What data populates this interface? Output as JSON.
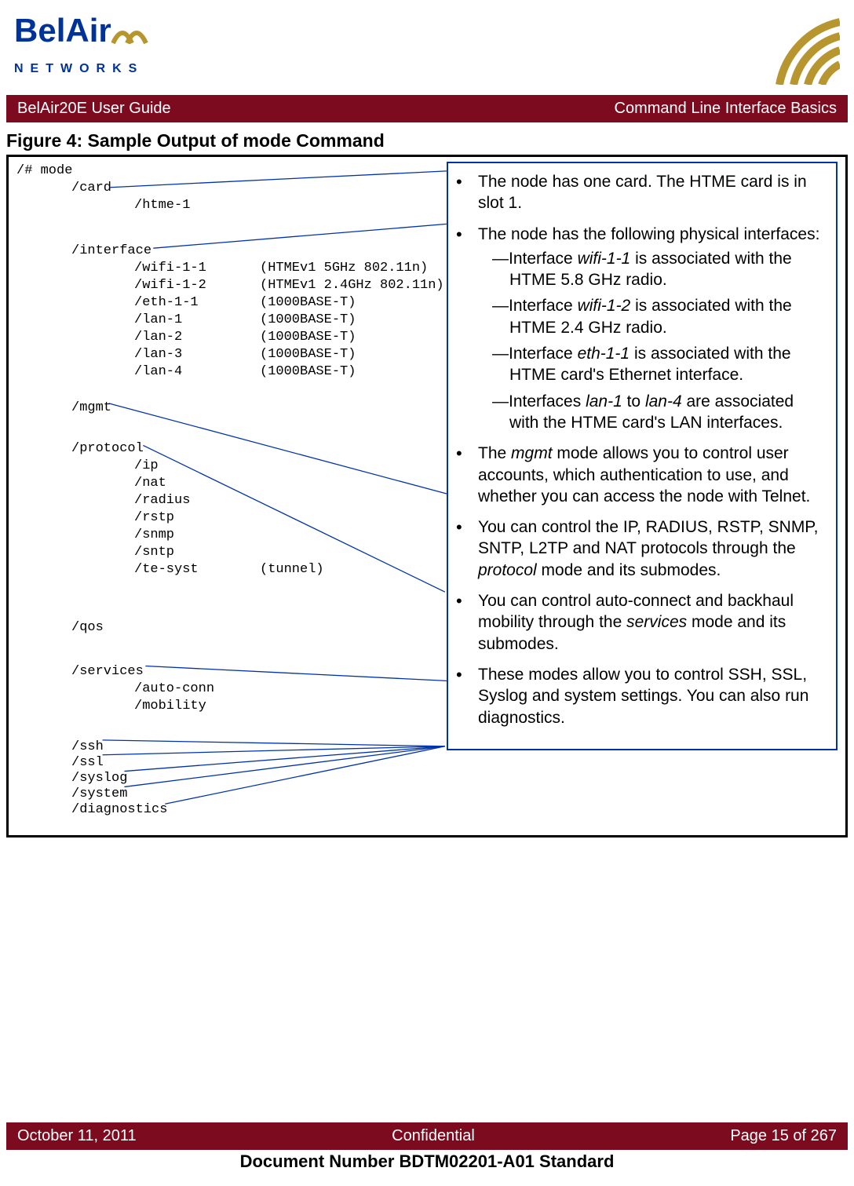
{
  "logo": {
    "brand_top": "BelAir",
    "brand_bottom": "NETWORKS"
  },
  "banner": {
    "left": "BelAir20E User Guide",
    "right": "Command Line Interface Basics"
  },
  "figure_title": "Figure 4: Sample Output of mode Command",
  "cli": {
    "root": "/# mode",
    "card": "/card",
    "htme": "/htme-1",
    "interface": "/interface",
    "if_rows": [
      {
        "name": "/wifi-1-1",
        "desc": "(HTMEv1 5GHz 802.11n)"
      },
      {
        "name": "/wifi-1-2",
        "desc": "(HTMEv1 2.4GHz 802.11n)"
      },
      {
        "name": "/eth-1-1",
        "desc": "(1000BASE-T)"
      },
      {
        "name": "/lan-1",
        "desc": "(1000BASE-T)"
      },
      {
        "name": "/lan-2",
        "desc": "(1000BASE-T)"
      },
      {
        "name": "/lan-3",
        "desc": "(1000BASE-T)"
      },
      {
        "name": "/lan-4",
        "desc": "(1000BASE-T)"
      }
    ],
    "mgmt": "/mgmt",
    "protocol": "/protocol",
    "proto_rows": [
      {
        "name": "/ip",
        "desc": ""
      },
      {
        "name": "/nat",
        "desc": ""
      },
      {
        "name": "/radius",
        "desc": ""
      },
      {
        "name": "/rstp",
        "desc": ""
      },
      {
        "name": "/snmp",
        "desc": ""
      },
      {
        "name": "/sntp",
        "desc": ""
      },
      {
        "name": "/te-syst",
        "desc": "(tunnel)"
      }
    ],
    "qos": "/qos",
    "services": "/services",
    "svc_rows": [
      "/auto-conn",
      "/mobility"
    ],
    "tail": [
      "/ssh",
      "/ssl",
      "/syslog",
      "/system",
      "/diagnostics"
    ]
  },
  "notes": {
    "n1a": "The node has one card. The HTME card is in slot 1.",
    "n2a": "The node has the following physical interfaces:",
    "n2s1a": "Interface ",
    "n2s1b": "wifi-1-1",
    "n2s1c": " is associated with the HTME 5.8 GHz radio.",
    "n2s2a": "Interface ",
    "n2s2b": "wifi-1-2",
    "n2s2c": " is associated with the HTME 2.4 GHz radio.",
    "n2s3a": "Interface ",
    "n2s3b": "eth-1-1",
    "n2s3c": " is associated with the HTME card's Ethernet interface.",
    "n2s4a": "Interfaces ",
    "n2s4b": "lan-1",
    "n2s4c": " to ",
    "n2s4d": "lan-4",
    "n2s4e": " are associated with the HTME card's LAN interfaces.",
    "n3a": "The ",
    "n3b": "mgmt",
    "n3c": " mode allows you to control user accounts, which authentication to use, and whether you can access the node with Telnet.",
    "n4a": "You can control the IP, RADIUS, RSTP, SNMP, SNTP, L2TP and NAT protocols through the ",
    "n4b": "protocol",
    "n4c": " mode and its submodes.",
    "n5a": "You can control auto-connect and backhaul mobility through the ",
    "n5b": "services",
    "n5c": " mode and its submodes.",
    "n6a": "These modes allow you to control SSH, SSL, Syslog and system settings. You can also run diagnostics."
  },
  "footer": {
    "left": "October 11, 2011",
    "center": "Confidential",
    "right": "Page 15 of 267",
    "doc": "Document Number BDTM02201-A01 Standard"
  }
}
